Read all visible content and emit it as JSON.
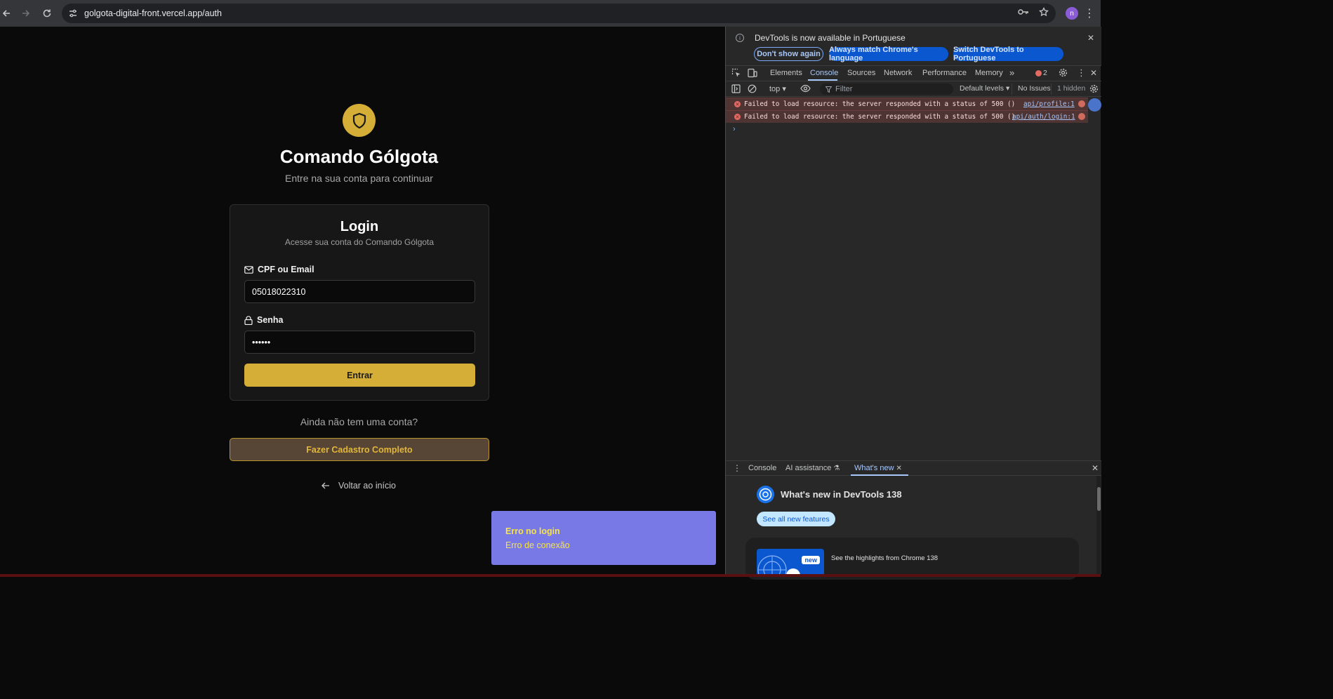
{
  "browser": {
    "url": "golgota-digital-front.vercel.app/auth",
    "profile_initial": "n"
  },
  "page": {
    "brand_title": "Comando Gólgota",
    "brand_subtitle": "Entre na sua conta para continuar",
    "login_card": {
      "title": "Login",
      "subtitle": "Acesse sua conta do Comando Gólgota",
      "cpf_label": "CPF ou Email",
      "cpf_value": "05018022310",
      "password_label": "Senha",
      "password_value": "••••••",
      "submit_label": "Entrar"
    },
    "no_account_text": "Ainda não tem uma conta?",
    "signup_label": "Fazer Cadastro Completo",
    "back_label": "Voltar ao início",
    "toast": {
      "title": "Erro no login",
      "description": "Erro de conexão"
    }
  },
  "devtools": {
    "infobar": {
      "message": "DevTools is now available in Portuguese",
      "dont_show": "Don't show again",
      "always_match": "Always match Chrome's language",
      "switch": "Switch DevTools to Portuguese"
    },
    "tabs": [
      "Elements",
      "Console",
      "Sources",
      "Network",
      "Performance",
      "Memory"
    ],
    "active_tab": "Console",
    "error_count": "2",
    "toolbar": {
      "context": "top",
      "filter_placeholder": "Filter",
      "levels": "Default levels",
      "issues": "No Issues",
      "hidden": "1 hidden"
    },
    "messages": [
      {
        "text": "Failed to load resource: the server responded with a status of 500 ()",
        "source": "api/profile:1"
      },
      {
        "text": "Failed to load resource: the server responded with a status of 500 ()",
        "source": "api/auth/login:1"
      }
    ],
    "drawer": {
      "tabs": [
        "Console",
        "AI assistance",
        "What's new"
      ],
      "active_tab": "What's new",
      "whats_new_title": "What's new in DevTools 138",
      "see_all": "See all new features",
      "badge": "new",
      "highlight": "See the highlights from Chrome 138"
    }
  },
  "colors": {
    "accent_gold": "#d4ae37",
    "toast_bg": "#7878e6",
    "toast_text": "#f6e44c",
    "page_bg": "#0a0a0a"
  }
}
